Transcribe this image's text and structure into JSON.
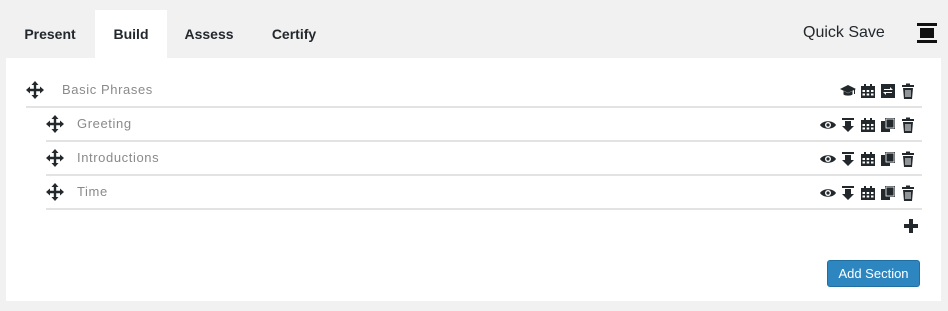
{
  "tabs": [
    {
      "label": "Present"
    },
    {
      "label": "Build"
    },
    {
      "label": "Assess"
    },
    {
      "label": "Certify"
    }
  ],
  "active_tab": "Build",
  "header": {
    "quick_save_label": "Quick Save",
    "menu_icon": "toggle-menu-icon"
  },
  "section": {
    "title": "Basic Phrases",
    "actions": [
      "graduation-cap-icon",
      "calendar-icon",
      "swap-icon",
      "trash-icon"
    ]
  },
  "lessons": [
    {
      "title": "Greeting",
      "actions": [
        "eye-icon",
        "download-icon",
        "calendar-icon",
        "copy-icon",
        "trash-icon"
      ]
    },
    {
      "title": "Introductions",
      "actions": [
        "eye-icon",
        "download-icon",
        "calendar-icon",
        "copy-icon",
        "trash-icon"
      ]
    },
    {
      "title": "Time",
      "actions": [
        "eye-icon",
        "download-icon",
        "calendar-icon",
        "copy-icon",
        "trash-icon"
      ]
    }
  ],
  "add_lesson_icon": "plus-icon",
  "add_section_label": "Add Section",
  "colors": {
    "accent": "#2e86c1",
    "background": "#f1f1f1",
    "panel": "#ffffff",
    "muted_text": "#8a8a8a"
  }
}
